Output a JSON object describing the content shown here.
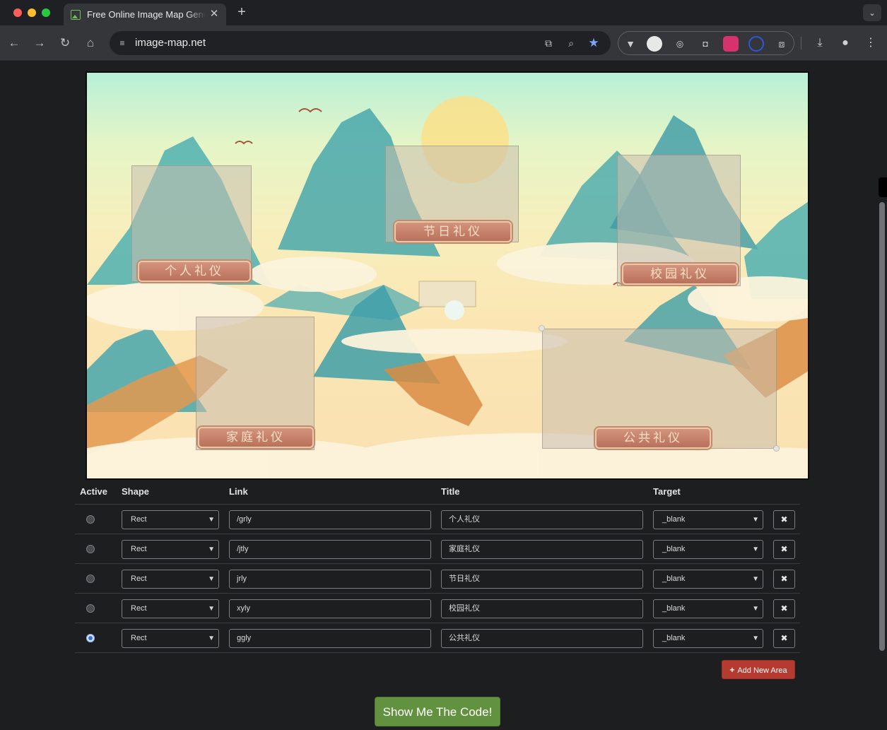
{
  "browser": {
    "tab_title": "Free Online Image Map Generator",
    "tab_close": "✕",
    "new_tab": "+",
    "url": "image-map.net",
    "colors": {
      "chrome_bg": "#35363a",
      "star": "#7ea6f6"
    }
  },
  "icons": {
    "back": "←",
    "forward": "→",
    "reload": "↻",
    "home": "⌂",
    "tune": "≡",
    "translate": "⧉",
    "zoom": "⌕",
    "star": "★",
    "puzzle": "⧈",
    "download": "⤓",
    "profile": "●",
    "menu": "⋮",
    "tab_search": "⌄"
  },
  "image_map": {
    "areas": [
      {
        "label": "个人礼仪"
      },
      {
        "label": "节日礼仪"
      },
      {
        "label": "校园礼仪"
      },
      {
        "label": "家庭礼仪"
      },
      {
        "label": "公共礼仪"
      }
    ]
  },
  "table": {
    "headers": {
      "active": "Active",
      "shape": "Shape",
      "link": "Link",
      "title": "Title",
      "target": "Target"
    },
    "delete_icon": "✖",
    "rows": [
      {
        "active": false,
        "shape": "Rect",
        "link": "/grly",
        "title": "个人礼仪",
        "target": "_blank"
      },
      {
        "active": false,
        "shape": "Rect",
        "link": "/jtly",
        "title": "家庭礼仪",
        "target": "_blank"
      },
      {
        "active": false,
        "shape": "Rect",
        "link": "jrly",
        "title": "节日礼仪",
        "target": "_blank"
      },
      {
        "active": false,
        "shape": "Rect",
        "link": "xyly",
        "title": "校园礼仪",
        "target": "_blank"
      },
      {
        "active": true,
        "shape": "Rect",
        "link": "ggly",
        "title": "公共礼仪",
        "target": "_blank"
      }
    ]
  },
  "buttons": {
    "add_area": "Add New Area",
    "show_code": "Show Me The Code!",
    "add_color": "#b53a30",
    "code_color": "#62913f"
  }
}
